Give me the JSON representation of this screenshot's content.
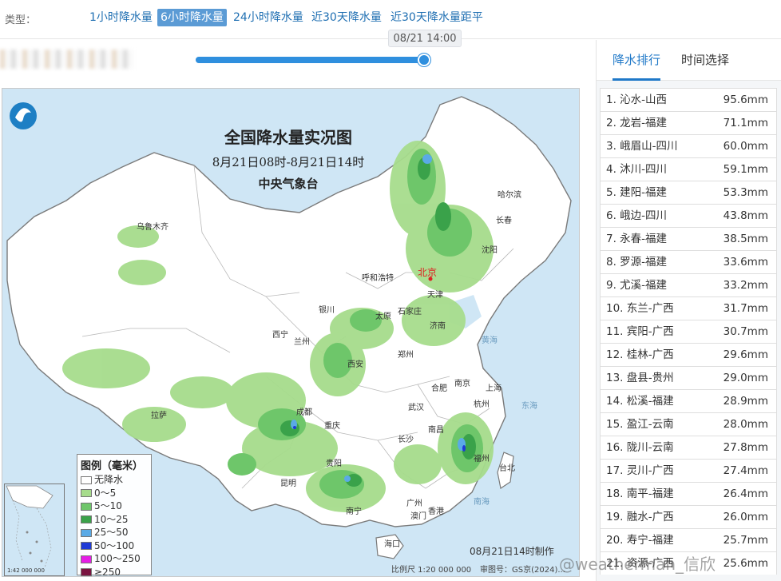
{
  "type_bar": {
    "label": "类型：",
    "tabs": [
      {
        "label": "1小时降水量",
        "active": false
      },
      {
        "label": "6小时降水量",
        "active": true
      },
      {
        "label": "24小时降水量",
        "active": false
      },
      {
        "label": "近30天降水量",
        "active": false
      },
      {
        "label": "近30天降水量距平",
        "active": false
      }
    ]
  },
  "slider": {
    "time_label": "08/21 14:00",
    "position_fraction": 1.0
  },
  "map": {
    "title": "全国降水量实况图",
    "subtitle": "8月21日08时-8月21日14时",
    "agency": "中央气象台",
    "footer_time": "08月21日14时制作",
    "scale_text": "比例尺 1:20 000 000",
    "approval_text": "审图号：GS京(2024)...",
    "inset_scale": "1:42 000 000",
    "cities": [
      "北京",
      "哈尔滨",
      "长春",
      "沈阳",
      "呼和浩特",
      "天津",
      "石家庄",
      "济南",
      "太原",
      "银川",
      "西宁",
      "兰州",
      "乌鲁木齐",
      "拉萨",
      "西安",
      "郑州",
      "合肥",
      "南京",
      "上海",
      "杭州",
      "武汉",
      "成都",
      "重庆",
      "长沙",
      "南昌",
      "福州",
      "台北",
      "贵阳",
      "昆明",
      "南宁",
      "广州",
      "澳门",
      "香港",
      "海口"
    ],
    "sea_labels": [
      "黄海",
      "东海",
      "南海"
    ],
    "legend": {
      "title": "图例（毫米）",
      "items": [
        {
          "label": "无降水",
          "color": "#ffffff"
        },
        {
          "label": "0～5",
          "color": "#a6dc8c"
        },
        {
          "label": "5～10",
          "color": "#6ec66a"
        },
        {
          "label": "10～25",
          "color": "#3aa24a"
        },
        {
          "label": "25～50",
          "color": "#5aaae6"
        },
        {
          "label": "50～100",
          "color": "#1f3ad6"
        },
        {
          "label": "100～250",
          "color": "#e61ee6"
        },
        {
          "label": "≥250",
          "color": "#7a1440"
        }
      ]
    }
  },
  "ranking": {
    "tabs": [
      {
        "label": "降水排行",
        "active": true
      },
      {
        "label": "时间选择",
        "active": false
      }
    ],
    "rows": [
      {
        "name": "1. 沁水-山西",
        "value": "95.6mm"
      },
      {
        "name": "2. 龙岩-福建",
        "value": "71.1mm"
      },
      {
        "name": "3. 峨眉山-四川",
        "value": "60.0mm"
      },
      {
        "name": "4. 沐川-四川",
        "value": "59.1mm"
      },
      {
        "name": "5. 建阳-福建",
        "value": "53.3mm"
      },
      {
        "name": "6. 峨边-四川",
        "value": "43.8mm"
      },
      {
        "name": "7. 永春-福建",
        "value": "38.5mm"
      },
      {
        "name": "8. 罗源-福建",
        "value": "33.6mm"
      },
      {
        "name": "9. 尤溪-福建",
        "value": "33.2mm"
      },
      {
        "name": "10. 东兰-广西",
        "value": "31.7mm"
      },
      {
        "name": "11. 宾阳-广西",
        "value": "30.7mm"
      },
      {
        "name": "12. 桂林-广西",
        "value": "29.6mm"
      },
      {
        "name": "13. 盘县-贵州",
        "value": "29.0mm"
      },
      {
        "name": "14. 松溪-福建",
        "value": "28.9mm"
      },
      {
        "name": "15. 盈江-云南",
        "value": "28.0mm"
      },
      {
        "name": "16. 陇川-云南",
        "value": "27.8mm"
      },
      {
        "name": "17. 灵川-广西",
        "value": "27.4mm"
      },
      {
        "name": "18. 南平-福建",
        "value": "26.4mm"
      },
      {
        "name": "19. 融水-广西",
        "value": "26.0mm"
      },
      {
        "name": "20. 寿宁-福建",
        "value": "25.7mm"
      },
      {
        "name": "21. 资源-广西",
        "value": "25.6mm"
      }
    ]
  },
  "watermark": "@weatherman_信欣"
}
